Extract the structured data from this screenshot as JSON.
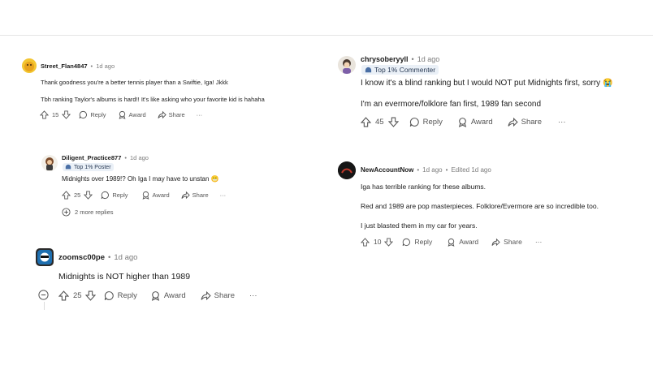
{
  "comments": [
    {
      "username": "Street_Flan4847",
      "time": "1d ago",
      "body": [
        "Thank goodness you're a better tennis player than a Swiftie, Iga! Jkkk",
        "Tbh ranking Taylor's albums is hard!! It's like asking who your favorite kid is hahaha"
      ],
      "votes": "15",
      "reply_label": "Reply",
      "award_label": "Award",
      "share_label": "Share",
      "more_label": "···"
    },
    {
      "username": "Diligent_Practice877",
      "time": "1d ago",
      "flair": "Top 1% Poster",
      "body": [
        "Midnights over 1989!? Oh Iga I may have to unstan 😬"
      ],
      "votes": "25",
      "reply_label": "Reply",
      "award_label": "Award",
      "share_label": "Share",
      "more_label": "···",
      "more_replies": "2 more replies"
    },
    {
      "username": "zoomsc00pe",
      "time": "1d ago",
      "body": [
        "Midnights is NOT higher than 1989"
      ],
      "votes": "25",
      "reply_label": "Reply",
      "award_label": "Award",
      "share_label": "Share",
      "more_label": "···"
    },
    {
      "username": "chrysoberyyll",
      "time": "1d ago",
      "flair": "Top 1% Commenter",
      "body": [
        "I know it's a blind ranking but I would NOT put Midnights first, sorry 😭",
        "I'm an evermore/folklore fan first, 1989 fan second"
      ],
      "votes": "45",
      "reply_label": "Reply",
      "award_label": "Award",
      "share_label": "Share",
      "more_label": "···"
    },
    {
      "username": "NewAccountNow",
      "time": "1d ago",
      "edited": "Edited 1d ago",
      "body": [
        "Iga has terrible ranking for these albums.",
        "Red and 1989 are pop masterpieces. Folklore/Evermore are so incredible too.",
        "I just blasted them in my car for years."
      ],
      "votes": "10",
      "reply_label": "Reply",
      "award_label": "Award",
      "share_label": "Share",
      "more_label": "···"
    }
  ],
  "colors": {
    "text": "#1c1c1c",
    "muted": "#7c7c7c",
    "flair_bg": "#eaf0f7",
    "divider": "#e5e5e5"
  },
  "icons": [
    "upvote-icon",
    "downvote-icon",
    "reply-icon",
    "award-icon",
    "share-icon",
    "more-icon",
    "expand-icon",
    "collapse-icon"
  ]
}
